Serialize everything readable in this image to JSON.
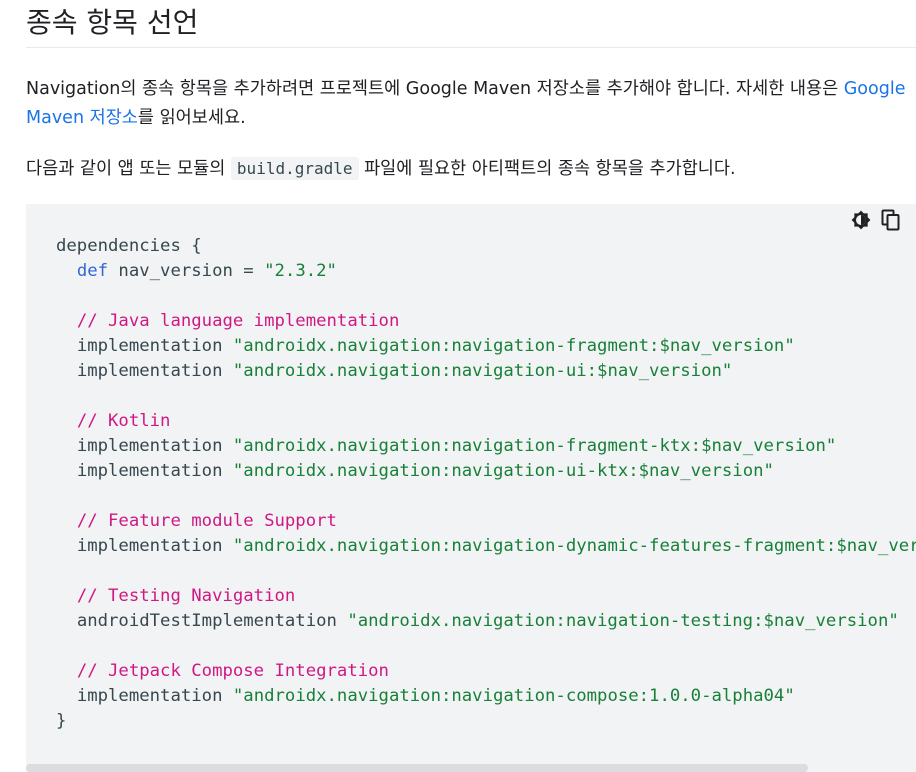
{
  "heading": "종속 항목 선언",
  "para1": {
    "text_before": "Navigation의 종속 항목을 추가하려면 프로젝트에 Google Maven 저장소를 추가해야 합니다. 자세한 내용은 ",
    "link_text": "Google Maven 저장소",
    "text_after": "를 읽어보세요."
  },
  "para2": {
    "text_before": "다음과 같이 앱 또는 모듈의 ",
    "code": "build.gradle",
    "text_after": " 파일에 필요한 아티팩트의 종속 항목을 추가합니다."
  },
  "toolbar": {
    "theme_icon": "dark-mode-icon",
    "copy_icon": "copy-icon"
  },
  "code": {
    "l1": "dependencies {",
    "l2_kw": "def",
    "l2_rest": " nav_version = ",
    "l2_str": "\"2.3.2\"",
    "c1": "// Java language implementation",
    "impl": "implementation",
    "s1": "\"androidx.navigation:navigation-fragment:$nav_version\"",
    "s2": "\"androidx.navigation:navigation-ui:$nav_version\"",
    "c2": "// Kotlin",
    "s3": "\"androidx.navigation:navigation-fragment-ktx:$nav_version\"",
    "s4": "\"androidx.navigation:navigation-ui-ktx:$nav_version\"",
    "c3": "// Feature module Support",
    "s5": "\"androidx.navigation:navigation-dynamic-features-fragment:$nav_version\"",
    "c4": "// Testing Navigation",
    "test_impl": "androidTestImplementation",
    "s6": "\"androidx.navigation:navigation-testing:$nav_version\"",
    "c5": "// Jetpack Compose Integration",
    "s7": "\"androidx.navigation:navigation-compose:1.0.0-alpha04\"",
    "close": "}"
  },
  "colors": {
    "link": "#1a73e8",
    "keyword": "#3367d6",
    "string": "#188038",
    "comment": "#d01884",
    "code_bg": "#f1f3f4"
  }
}
